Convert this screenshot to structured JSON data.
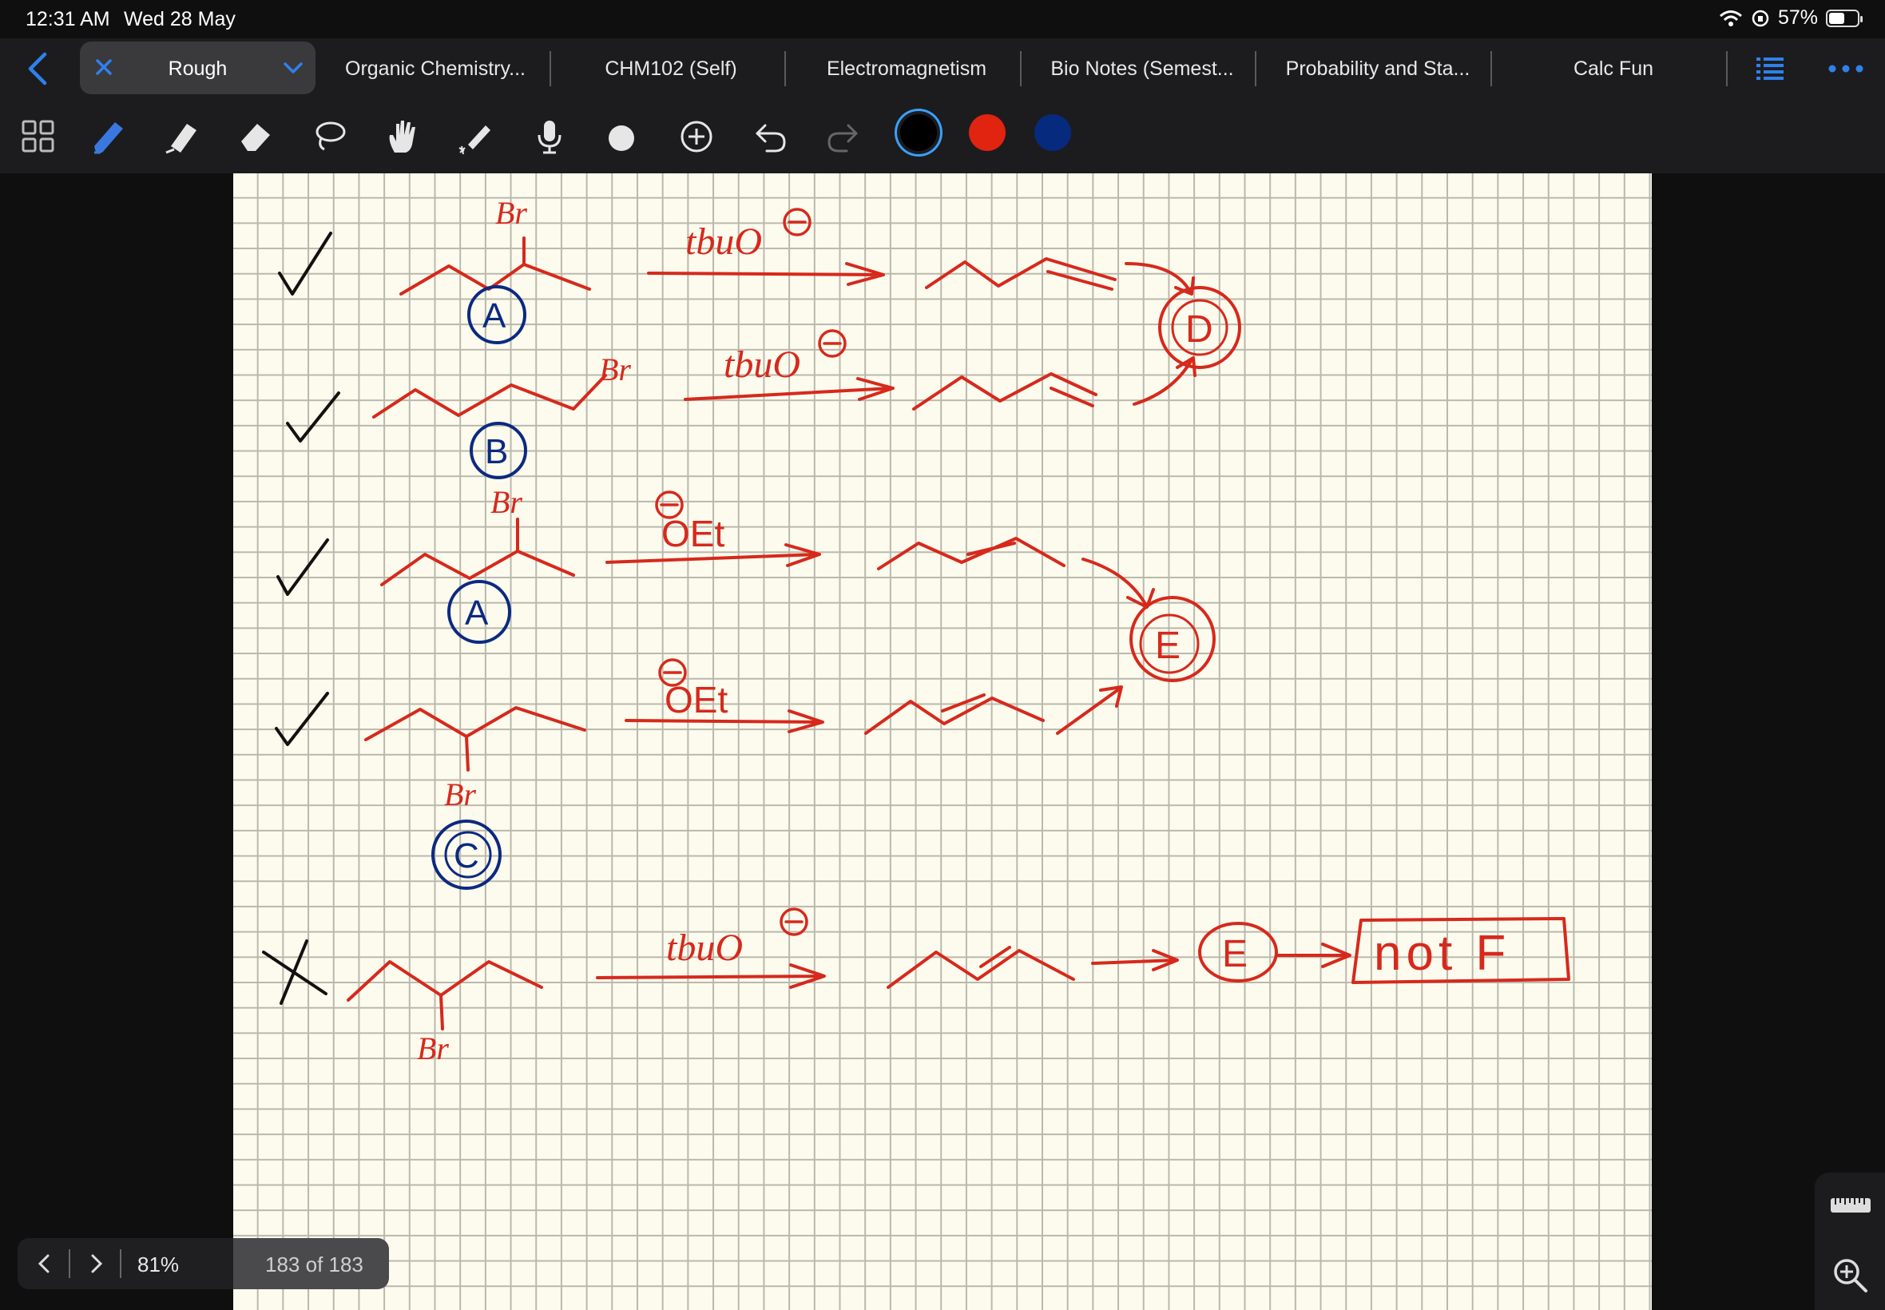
{
  "status": {
    "time": "12:31 AM",
    "date": "Wed 28 May",
    "battery": "57%",
    "battery_level": 0.57
  },
  "tabs": {
    "active": "Rough",
    "items": [
      "Organic Chemistry...",
      "CHM102 (Self)",
      "Electromagnetism",
      "Bio Notes (Semest...",
      "Probability and Sta...",
      "Calc Fun"
    ]
  },
  "colors": {
    "black": "#000000",
    "red": "#e0240f",
    "blue": "#062a7e",
    "ink_red": "#d6291c",
    "ink_blue": "#0b2a80",
    "accent": "#2f80ed"
  },
  "icons": [
    "grid-icon",
    "pen-icon",
    "highlighter-icon",
    "eraser-icon",
    "lasso-icon",
    "hand-icon",
    "laser-pointer-icon",
    "microphone-icon",
    "shapes-icon",
    "add-icon",
    "undo-icon",
    "redo-icon"
  ],
  "note": {
    "reagent_tbuo": "tbuO",
    "reagent_oet": "OEt",
    "label_br": "Br",
    "circle_a": "A",
    "circle_b": "B",
    "circle_c": "C",
    "circle_d": "D",
    "circle_e": "E",
    "result_box": "not F"
  },
  "pager": {
    "zoom": "81%",
    "page_info": "183 of 183"
  }
}
